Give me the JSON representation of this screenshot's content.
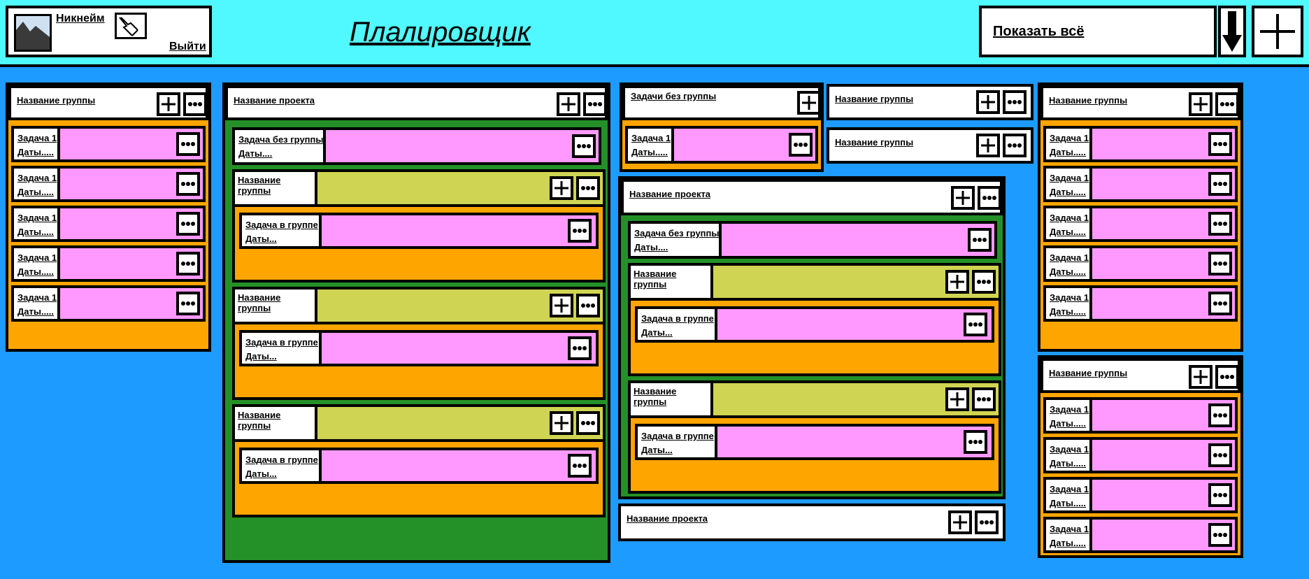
{
  "header": {
    "app_title": "Плалировщик",
    "user": {
      "nickname": "Никнейм",
      "logout": "Выйти"
    },
    "filter": {
      "selected": "Показать всё"
    }
  },
  "labels": {
    "group_title": "Название группы",
    "project_title": "Название проекта",
    "ungrouped_title": "Задачи без группы",
    "task_title": "Задача 1",
    "task_dates": "Даты.....",
    "task_ungrouped": "Задача без группы",
    "task_ungrouped_dates": "Даты....",
    "task_in_group": "Задача в группе",
    "task_in_group_dates": "Даты..."
  },
  "colors": {
    "background": "#1E9BFF",
    "topbar": "#4FF9FF",
    "group_body": "#FFA500",
    "project_body": "#249128",
    "nested_group_header": "#CFD452",
    "task": "#FF99FF"
  },
  "icons": [
    "avatar-icon",
    "edit-icon",
    "dropdown-arrow-icon",
    "plus-icon",
    "more-icon"
  ]
}
